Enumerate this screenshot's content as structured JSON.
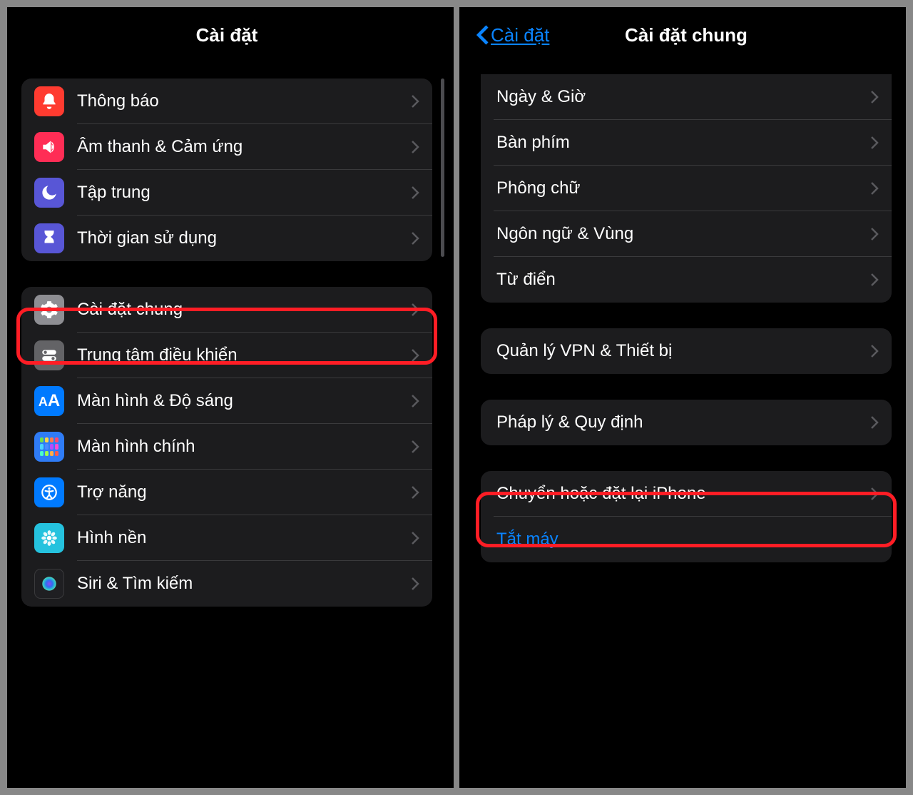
{
  "left": {
    "title": "Cài đặt",
    "group1": [
      {
        "label": "Thông báo",
        "icon": "bell-icon"
      },
      {
        "label": "Âm thanh & Cảm ứng",
        "icon": "sound-icon"
      },
      {
        "label": "Tập trung",
        "icon": "moon-icon"
      },
      {
        "label": "Thời gian sử dụng",
        "icon": "hourglass-icon"
      }
    ],
    "group2": [
      {
        "label": "Cài đặt chung",
        "icon": "gear-icon",
        "highlight": true
      },
      {
        "label": "Trung tâm điều khiển",
        "icon": "switches-icon"
      },
      {
        "label": "Màn hình & Độ sáng",
        "icon": "textsize-icon"
      },
      {
        "label": "Màn hình chính",
        "icon": "homescreen-icon"
      },
      {
        "label": "Trợ năng",
        "icon": "accessibility-icon"
      },
      {
        "label": "Hình nền",
        "icon": "flower-icon"
      },
      {
        "label": "Siri & Tìm kiếm",
        "icon": "siri-icon"
      }
    ]
  },
  "right": {
    "back": "Cài đặt",
    "title": "Cài đặt chung",
    "group1": [
      {
        "label": "Ngày & Giờ"
      },
      {
        "label": "Bàn phím"
      },
      {
        "label": "Phông chữ"
      },
      {
        "label": "Ngôn ngữ & Vùng"
      },
      {
        "label": "Từ điển"
      }
    ],
    "group2": [
      {
        "label": "Quản lý VPN & Thiết bị"
      }
    ],
    "group3": [
      {
        "label": "Pháp lý & Quy định"
      }
    ],
    "group4": [
      {
        "label": "Chuyển hoặc đặt lại iPhone",
        "highlight": true
      },
      {
        "label": "Tắt máy",
        "blue": true,
        "nochev": true
      }
    ]
  }
}
